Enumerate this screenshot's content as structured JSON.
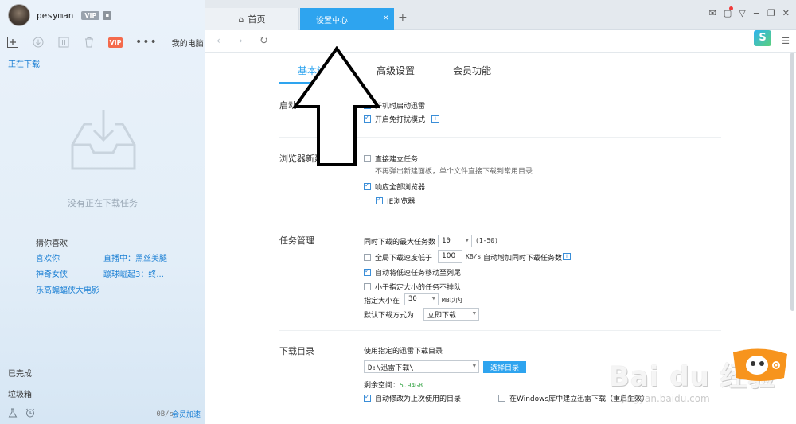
{
  "user": {
    "name": "pesyman",
    "vip": "VIP",
    "level": ""
  },
  "toolbar": {
    "dots": "•••",
    "mypc": "我的电脑",
    "vip_label": "VIP"
  },
  "left": {
    "downloading": "正在下载",
    "empty_text": "没有正在下载任务",
    "guess_title": "猜你喜欢",
    "guess": [
      "喜欢你",
      "直播中：黑丝美腿",
      "神奇女侠",
      "蹦球崛起3：终...",
      "乐高蝙蝠侠大电影"
    ],
    "completed": "已完成",
    "trash": "垃圾箱",
    "speed": "0B/s",
    "accelerate": "会员加速"
  },
  "tabs": {
    "home": "首页",
    "settings": "设置中心",
    "close": "×",
    "add": "+"
  },
  "settings_tabs": [
    "基本设置",
    "高级设置",
    "会员功能"
  ],
  "startup": {
    "title": "启动",
    "opt1": "开机时启动迅雷",
    "opt2": "开启免打扰模式",
    "info": "i"
  },
  "browser": {
    "title": "浏览器新建任务",
    "opt1": "直接建立任务",
    "hint1": "不再弹出新建面板，单个文件直接下载到常用目录",
    "opt2": "响应全部浏览器",
    "opt3": "IE浏览器"
  },
  "tasks": {
    "title": "任务管理",
    "max_label": "同时下载的最大任务数",
    "max_value": "10",
    "max_range": "(1-50)",
    "lowspeed_label": "全局下载速度低于",
    "lowspeed_value": "100",
    "lowspeed_unit": "KB/s",
    "lowspeed_tail": "自动增加同时下载任务数",
    "auto_move": "自动将低速任务移动至列尾",
    "small_task": "小于指定大小的任务不排队",
    "size_label": "指定大小在",
    "size_value": "30",
    "size_unit": "MB以内",
    "mode_label": "默认下载方式为",
    "mode_value": "立即下载"
  },
  "dir": {
    "title": "下载目录",
    "label": "使用指定的迅雷下载目录",
    "path": "D:\\迅雷下载\\",
    "choose": "选择目录",
    "free_label": "剩余空间：",
    "free_value": "5.94GB",
    "auto_change": "自动修改为上次使用的目录",
    "win_lib": "在Windows库中建立迅雷下载（重启生效）"
  },
  "watermark": {
    "text": "Bai du 经验",
    "url": "jingyan.baidu.com"
  },
  "colors": {
    "accent": "#2ea4ef",
    "link": "#1a7fd4",
    "vip": "#f46a4c"
  }
}
